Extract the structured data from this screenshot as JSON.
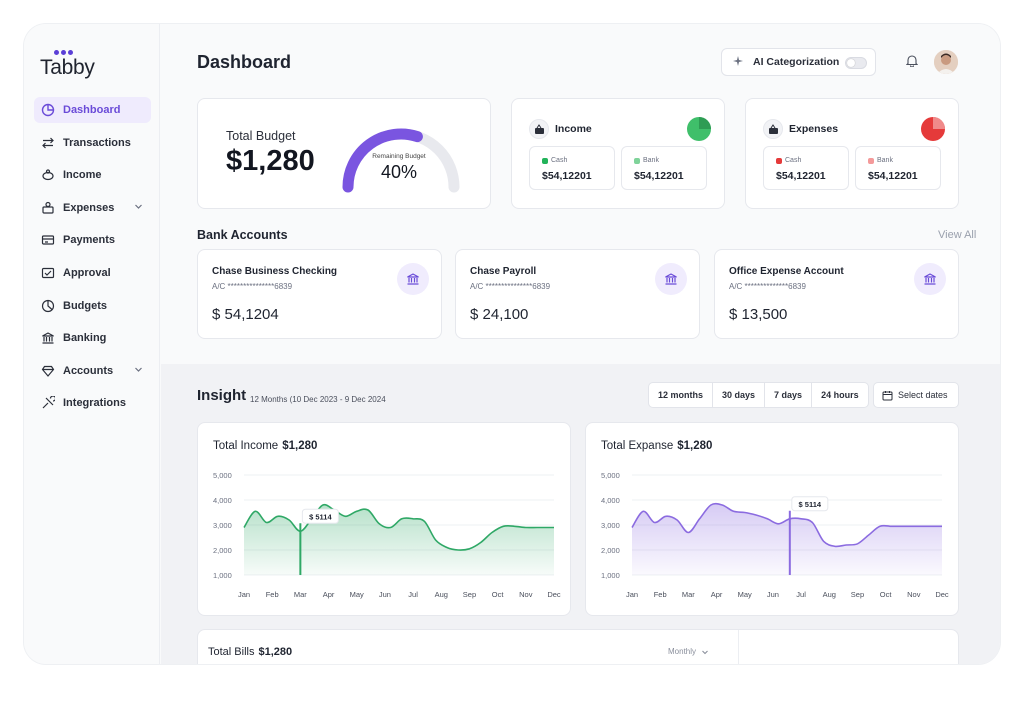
{
  "app": {
    "logo": "Tabby",
    "brand_color": "#6a4bd8"
  },
  "sidebar": {
    "items": [
      {
        "label": "Dashboard",
        "icon": "dashboard-icon",
        "active": true
      },
      {
        "label": "Transactions",
        "icon": "transactions-icon"
      },
      {
        "label": "Income",
        "icon": "income-icon"
      },
      {
        "label": "Expenses",
        "icon": "expenses-icon",
        "has_children": true
      },
      {
        "label": "Payments",
        "icon": "payments-icon"
      },
      {
        "label": "Approval",
        "icon": "approval-icon"
      },
      {
        "label": "Budgets",
        "icon": "budgets-icon"
      },
      {
        "label": "Banking",
        "icon": "banking-icon"
      },
      {
        "label": "Accounts",
        "icon": "accounts-icon",
        "has_children": true
      },
      {
        "label": "Integrations",
        "icon": "integrations-icon"
      }
    ]
  },
  "header": {
    "title": "Dashboard",
    "ai_toggle_label": "AI Categorization",
    "ai_toggle_on": false
  },
  "budget": {
    "label": "Total Budget",
    "amount": "$1,280",
    "gauge_label": "Remaining Budget",
    "gauge_value": "40%",
    "gauge_fraction": 0.6
  },
  "income": {
    "title": "Income",
    "pie_color": "#3fbf6a",
    "cash_label": "Cash",
    "cash_value": "$54,12201",
    "bank_label": "Bank",
    "bank_value": "$54,12201",
    "cash_color": "#22b35a",
    "bank_color": "#7fd39a"
  },
  "expenses": {
    "title": "Expenses",
    "pie_color": "#e54848",
    "cash_label": "Cash",
    "cash_value": "$54,12201",
    "bank_label": "Bank",
    "bank_value": "$54,12201",
    "cash_color": "#e53a3a",
    "bank_color": "#f49a9a"
  },
  "bank_accounts": {
    "title": "Bank Accounts",
    "view_all": "View All",
    "accounts": [
      {
        "name": "Chase Business Checking",
        "acc": "A/C ***************6839",
        "balance": "$ 54,1204"
      },
      {
        "name": "Chase Payroll",
        "acc": "A/C ***************6839",
        "balance": "$ 24,100"
      },
      {
        "name": "Office Expense Account",
        "acc": "A/C **************6839",
        "balance": "$ 13,500"
      }
    ]
  },
  "insight": {
    "title": "Insight",
    "subtitle": "12 Months (10 Dec 2023  - 9 Dec 2024",
    "ranges": [
      "12 months",
      "30 days",
      "7 days",
      "24 hours"
    ],
    "select_dates": "Select dates"
  },
  "charts": {
    "income": {
      "title": "Total Income",
      "total": "$1,280",
      "tooltip": "$ 5114",
      "color": "#2fa866"
    },
    "expense": {
      "title": "Total Expanse",
      "total": "$1,280",
      "tooltip": "$ 5114",
      "color": "#8b6be0"
    }
  },
  "chart_data": [
    {
      "type": "area",
      "title": "Total Income $1,280",
      "categories": [
        "Jan",
        "Feb",
        "Mar",
        "Apr",
        "May",
        "Jun",
        "Jul",
        "Aug",
        "Sep",
        "Oct",
        "Nov",
        "Dec"
      ],
      "yticks": [
        "5,000",
        "4,000",
        "3,000",
        "2,000",
        "1,000"
      ],
      "ylim": [
        1000,
        5000
      ],
      "x": [
        0,
        0.4,
        0.8,
        1.2,
        1.6,
        2.0,
        2.4,
        2.8,
        3.2,
        3.6,
        4.0,
        4.4,
        4.8,
        5.2,
        5.6,
        6.0,
        6.4,
        6.8,
        7.2,
        7.6,
        8.0,
        8.4,
        8.8,
        9.2,
        9.6,
        10.0,
        10.4,
        10.8,
        11.0
      ],
      "values": [
        2900,
        3550,
        3100,
        3350,
        3200,
        2750,
        3250,
        3800,
        3600,
        3350,
        3550,
        3600,
        3050,
        2900,
        3250,
        3250,
        3150,
        2400,
        2100,
        2000,
        2050,
        2300,
        2700,
        2950,
        2950,
        2900,
        2900,
        2900,
        2900
      ],
      "tooltip": {
        "x": 2.0,
        "label": "$ 5114"
      }
    },
    {
      "type": "area",
      "title": "Total Expanse $1,280",
      "categories": [
        "Jan",
        "Feb",
        "Mar",
        "Apr",
        "May",
        "Jun",
        "Jul",
        "Aug",
        "Sep",
        "Oct",
        "Nov",
        "Dec"
      ],
      "yticks": [
        "5,000",
        "4,000",
        "3,000",
        "2,000",
        "1,000"
      ],
      "ylim": [
        1000,
        5000
      ],
      "x": [
        0,
        0.4,
        0.8,
        1.2,
        1.6,
        2.0,
        2.4,
        2.8,
        3.2,
        3.6,
        4.0,
        4.4,
        4.8,
        5.2,
        5.6,
        6.0,
        6.4,
        6.8,
        7.2,
        7.6,
        8.0,
        8.4,
        8.8,
        9.2,
        9.6,
        10.0,
        10.4,
        10.8,
        11.0
      ],
      "values": [
        2900,
        3550,
        3100,
        3350,
        3200,
        2700,
        3250,
        3800,
        3800,
        3550,
        3500,
        3400,
        3250,
        3050,
        3250,
        3250,
        3100,
        2350,
        2150,
        2200,
        2250,
        2600,
        2950,
        2950,
        2950,
        2950,
        2950,
        2950,
        2950
      ],
      "tooltip": {
        "x": 5.6,
        "label": "$ 5114"
      }
    }
  ],
  "bills": {
    "title": "Total Bills",
    "total": "$1,280",
    "period": "Monthly"
  }
}
